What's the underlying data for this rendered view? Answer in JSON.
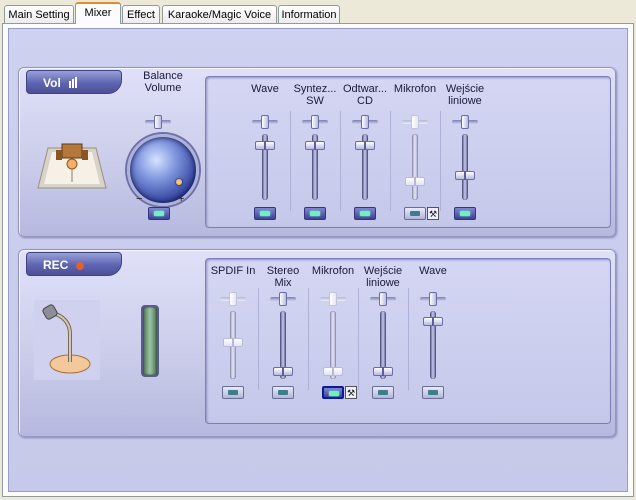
{
  "tabs": [
    {
      "label": "Main Setting"
    },
    {
      "label": "Mixer"
    },
    {
      "label": "Effect"
    },
    {
      "label": "Karaoke/Magic Voice"
    },
    {
      "label": "Information"
    }
  ],
  "active_tab": "Mixer",
  "playback": {
    "badge": "Vol",
    "balance_label_1": "Balance",
    "balance_label_2": "Volume",
    "minus": "−",
    "plus": "+",
    "channels": [
      {
        "name_1": "Wave",
        "name_2": "",
        "level": 0.88,
        "balance": 0.5,
        "enabled": true,
        "active": true
      },
      {
        "name_1": "Syntez...",
        "name_2": "SW",
        "level": 0.88,
        "balance": 0.5,
        "enabled": true,
        "active": true
      },
      {
        "name_1": "Odtwar...",
        "name_2": "CD",
        "level": 0.88,
        "balance": 0.5,
        "enabled": true,
        "active": true
      },
      {
        "name_1": "Mikrofon",
        "name_2": "",
        "level": 0.25,
        "balance": 0.5,
        "enabled": false,
        "active": false
      },
      {
        "name_1": "Wejście",
        "name_2": "liniowe",
        "level": 0.35,
        "balance": 0.5,
        "enabled": true,
        "active": true
      }
    ]
  },
  "record": {
    "badge": "REC",
    "channels": [
      {
        "name_1": "SPDIF In",
        "name_2": "",
        "level": 0.55,
        "balance": 0.5,
        "enabled": false,
        "active": false
      },
      {
        "name_1": "Stereo",
        "name_2": "Mix",
        "level": 0.05,
        "balance": 0.5,
        "enabled": true,
        "active": false
      },
      {
        "name_1": "Mikrofon",
        "name_2": "",
        "level": 0.05,
        "balance": 0.5,
        "enabled": false,
        "active": true
      },
      {
        "name_1": "Wejście",
        "name_2": "liniowe",
        "level": 0.05,
        "balance": 0.5,
        "enabled": true,
        "active": false
      },
      {
        "name_1": "Wave",
        "name_2": "",
        "level": 0.9,
        "balance": 0.5,
        "enabled": true,
        "active": false
      }
    ]
  },
  "icons": {
    "speaker": "speaker-icon",
    "microphone": "microphone-icon",
    "wrench": "wrench-icon"
  },
  "colors": {
    "panel": "#c9cbe9",
    "accent": "#5e64b0",
    "led_on": "#6ef0c0",
    "tab_highlight": "#e68b2c"
  }
}
